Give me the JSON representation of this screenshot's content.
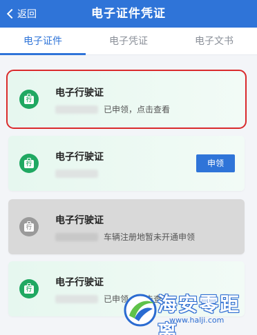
{
  "header": {
    "back_label": "返回",
    "title": "电子证件凭证"
  },
  "tabs": [
    {
      "label": "电子证件",
      "active": true
    },
    {
      "label": "电子凭证",
      "active": false
    },
    {
      "label": "电子文书",
      "active": false
    }
  ],
  "cards": [
    {
      "title": "电子行驶证",
      "icon_char": "行",
      "status": "已申领，点击查看",
      "button": "",
      "state": "applied-selected"
    },
    {
      "title": "电子行驶证",
      "icon_char": "行",
      "status": "",
      "button": "申领",
      "state": "available"
    },
    {
      "title": "电子行驶证",
      "icon_char": "行",
      "status": "车辆注册地暂未开通申领",
      "button": "",
      "state": "unavailable"
    },
    {
      "title": "电子行驶证",
      "icon_char": "行",
      "status": "已申领，点击查看",
      "button": "",
      "state": "applied"
    }
  ],
  "watermark": {
    "text": "海安零距离",
    "url": "www.halji.com"
  },
  "colors": {
    "primary": "#2f74d8",
    "license_green": "#20a862",
    "selection_red": "#d92b2b",
    "disabled_gray": "#d9d9d9"
  }
}
